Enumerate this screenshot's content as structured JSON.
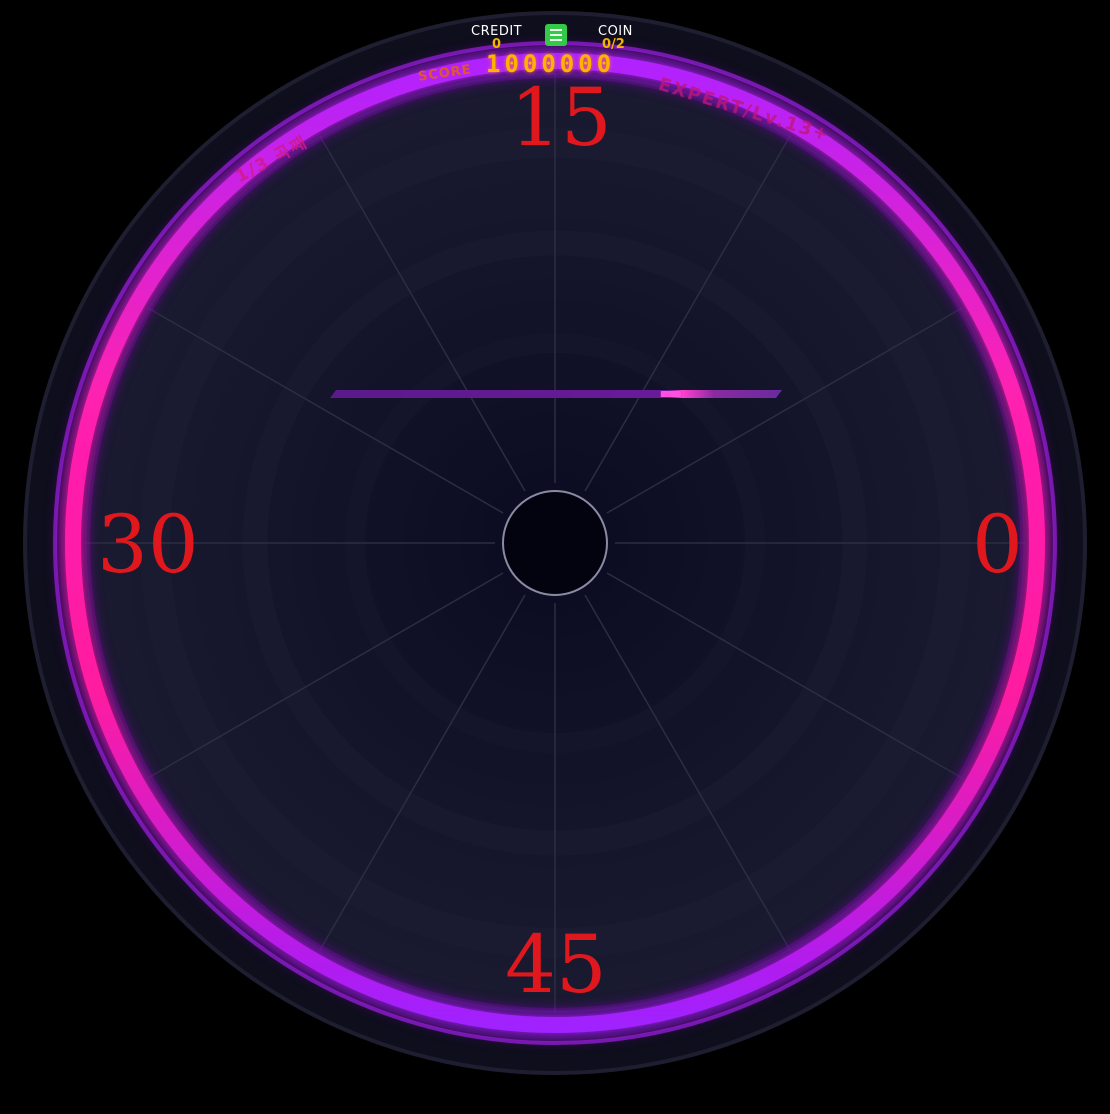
{
  "hud": {
    "credit_label": "CREDIT",
    "credit_value": "0",
    "coin_label": "COIN",
    "coin_value": "0/2",
    "score_label": "SCORE",
    "score_value": "1000000",
    "difficulty": "EXPERT/Lv.13+",
    "track": "1/3 곡째"
  },
  "lane_labels": {
    "right": "0",
    "top": "15",
    "left": "30",
    "bottom": "45"
  },
  "progress": 0.92,
  "colors": {
    "ring_outer": "#a020ff",
    "ring_inner": "#ff1aa8",
    "lane_number": "#e0181e",
    "score": "#ffb300",
    "background": "#0b0b1a"
  },
  "icons": {
    "network_status": "network-status-icon"
  }
}
